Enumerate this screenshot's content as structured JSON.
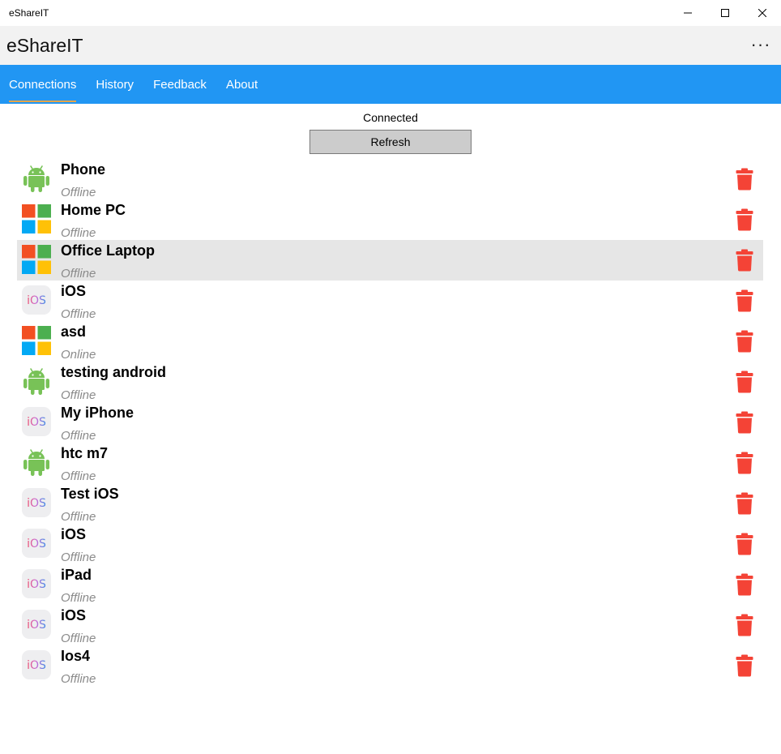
{
  "window": {
    "title": "eShareIT"
  },
  "header": {
    "app_title": "eShareIT",
    "more_label": "···"
  },
  "nav": {
    "tabs": [
      {
        "label": "Connections",
        "active": true
      },
      {
        "label": "History",
        "active": false
      },
      {
        "label": "Feedback",
        "active": false
      },
      {
        "label": "About",
        "active": false
      }
    ]
  },
  "main": {
    "status_text": "Connected",
    "refresh_label": "Refresh",
    "devices": [
      {
        "name": "Phone",
        "status": "Offline",
        "platform": "android-icon"
      },
      {
        "name": "Home PC",
        "status": "Offline",
        "platform": "windows-icon"
      },
      {
        "name": "Office Laptop",
        "status": "Offline",
        "platform": "windows-icon",
        "selected": true
      },
      {
        "name": "iOS",
        "status": "Offline",
        "platform": "ios-icon"
      },
      {
        "name": "asd",
        "status": "Online",
        "platform": "windows-icon"
      },
      {
        "name": "testing android",
        "status": "Offline",
        "platform": "android-icon"
      },
      {
        "name": "My iPhone",
        "status": "Offline",
        "platform": "ios-icon"
      },
      {
        "name": "htc m7",
        "status": "Offline",
        "platform": "android-icon"
      },
      {
        "name": "Test iOS",
        "status": "Offline",
        "platform": "ios-icon"
      },
      {
        "name": "iOS",
        "status": "Offline",
        "platform": "ios-icon"
      },
      {
        "name": "iPad",
        "status": "Offline",
        "platform": "ios-icon"
      },
      {
        "name": "iOS",
        "status": "Offline",
        "platform": "ios-icon"
      },
      {
        "name": "Ios4",
        "status": "Offline",
        "platform": "ios-icon"
      }
    ]
  },
  "icons": {
    "ios_label": "iOS"
  },
  "colors": {
    "nav_blue": "#2196f3",
    "tab_underline": "#e5a54a",
    "android_green": "#78c257",
    "trash_red": "#f44336",
    "win_red": "#f25022",
    "win_green": "#4caf50",
    "win_blue": "#03a9f4",
    "win_yellow": "#ffc107"
  }
}
